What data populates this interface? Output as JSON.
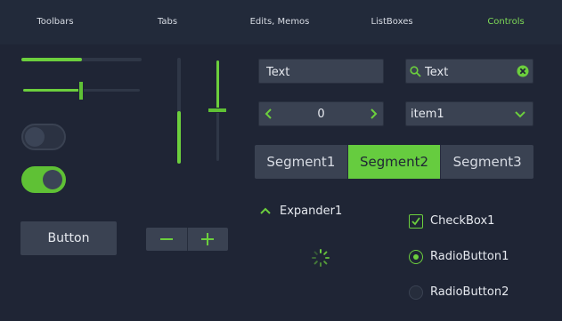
{
  "colors": {
    "accent": "#6ccf3d",
    "background": "#1f2535",
    "control": "#3a4252"
  },
  "tabs": [
    {
      "label": "Toolbars",
      "active": false
    },
    {
      "label": "Tabs",
      "active": false
    },
    {
      "label": "Edits, Memos",
      "active": false
    },
    {
      "label": "ListBoxes",
      "active": false
    },
    {
      "label": "Controls",
      "active": true
    }
  ],
  "progress_horizontal": {
    "value_fraction": 0.5
  },
  "slider_horizontal": {
    "value_fraction": 0.5
  },
  "progress_vertical": {
    "value_fraction": 0.5
  },
  "slider_vertical": {
    "value_fraction": 0.5
  },
  "toggles": [
    {
      "state": "off"
    },
    {
      "state": "on"
    }
  ],
  "button": {
    "label": "Button"
  },
  "stepper_buttons": {
    "minus_icon": "minus-icon",
    "plus_icon": "plus-icon"
  },
  "text_field": {
    "value": "Text"
  },
  "search_field": {
    "value": "Text",
    "icon": "search-icon",
    "clear_icon": "clear-icon"
  },
  "number_spinner": {
    "value": "0"
  },
  "combo": {
    "selected": "item1"
  },
  "segments": [
    {
      "label": "Segment1",
      "selected": false
    },
    {
      "label": "Segment2",
      "selected": true
    },
    {
      "label": "Segment3",
      "selected": false
    }
  ],
  "expander": {
    "label": "Expander1",
    "expanded": true
  },
  "checkbox": {
    "label": "CheckBox1",
    "checked": true
  },
  "radios": [
    {
      "label": "RadioButton1",
      "checked": true
    },
    {
      "label": "RadioButton2",
      "checked": false
    }
  ]
}
